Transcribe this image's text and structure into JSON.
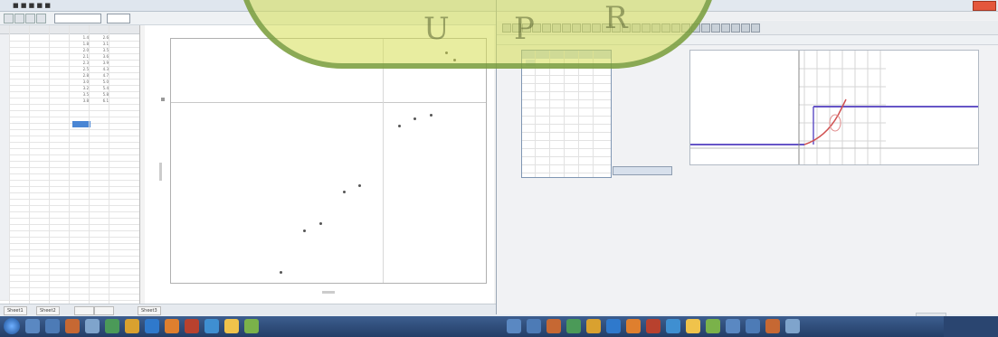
{
  "left_window": {
    "title": "■ ■ ■ ■ ■",
    "sheet": {
      "rows": [
        [
          "",
          "",
          "",
          "1.4",
          "2.6",
          ""
        ],
        [
          "",
          "",
          "",
          "1.8",
          "3.1",
          ""
        ],
        [
          "",
          "",
          "",
          "2.0",
          "3.5",
          ""
        ],
        [
          "",
          "",
          "",
          "2.1",
          "3.6",
          ""
        ],
        [
          "",
          "",
          "",
          "2.3",
          "3.9",
          ""
        ],
        [
          "",
          "",
          "",
          "2.5",
          "4.3",
          ""
        ],
        [
          "",
          "",
          "",
          "2.8",
          "4.7",
          ""
        ],
        [
          "",
          "",
          "",
          "3.0",
          "5.0",
          ""
        ],
        [
          "",
          "",
          "",
          "3.2",
          "5.4",
          ""
        ],
        [
          "",
          "",
          "",
          "3.5",
          "5.8",
          ""
        ],
        [
          "",
          "",
          "",
          "3.8",
          "6.1",
          ""
        ],
        [
          "",
          "",
          "",
          "",
          "",
          ""
        ]
      ]
    },
    "tabs": [
      "Sheet1",
      "Sheet2",
      "",
      "",
      "Sheet3"
    ]
  },
  "scatter": {
    "chart_data": {
      "type": "scatter",
      "points": [
        [
          1.4,
          0.3
        ],
        [
          1.7,
          1.5
        ],
        [
          1.9,
          1.7
        ],
        [
          2.2,
          2.6
        ],
        [
          2.4,
          2.8
        ],
        [
          2.9,
          4.5
        ],
        [
          3.1,
          4.7
        ],
        [
          3.3,
          4.8
        ],
        [
          3.5,
          6.6
        ],
        [
          3.6,
          6.4
        ]
      ],
      "xlim": [
        0,
        4
      ],
      "ylim": [
        0,
        7
      ],
      "xticks": [
        "",
        ""
      ],
      "yticks": [
        ""
      ],
      "xlabel": "",
      "ylabel": ""
    }
  },
  "right_window": {
    "title": "",
    "menu": [
      "",
      "",
      "",
      "",
      "",
      "",
      "",
      "",
      "",
      ""
    ],
    "pane_labels": [
      "",
      "",
      ""
    ],
    "algebra_rows": 14
  },
  "colors": {
    "graph_line": "#6655c7",
    "graph_curve": "#d05050",
    "watermark_fill": "#d6de52",
    "watermark_border": "#6c943c"
  }
}
